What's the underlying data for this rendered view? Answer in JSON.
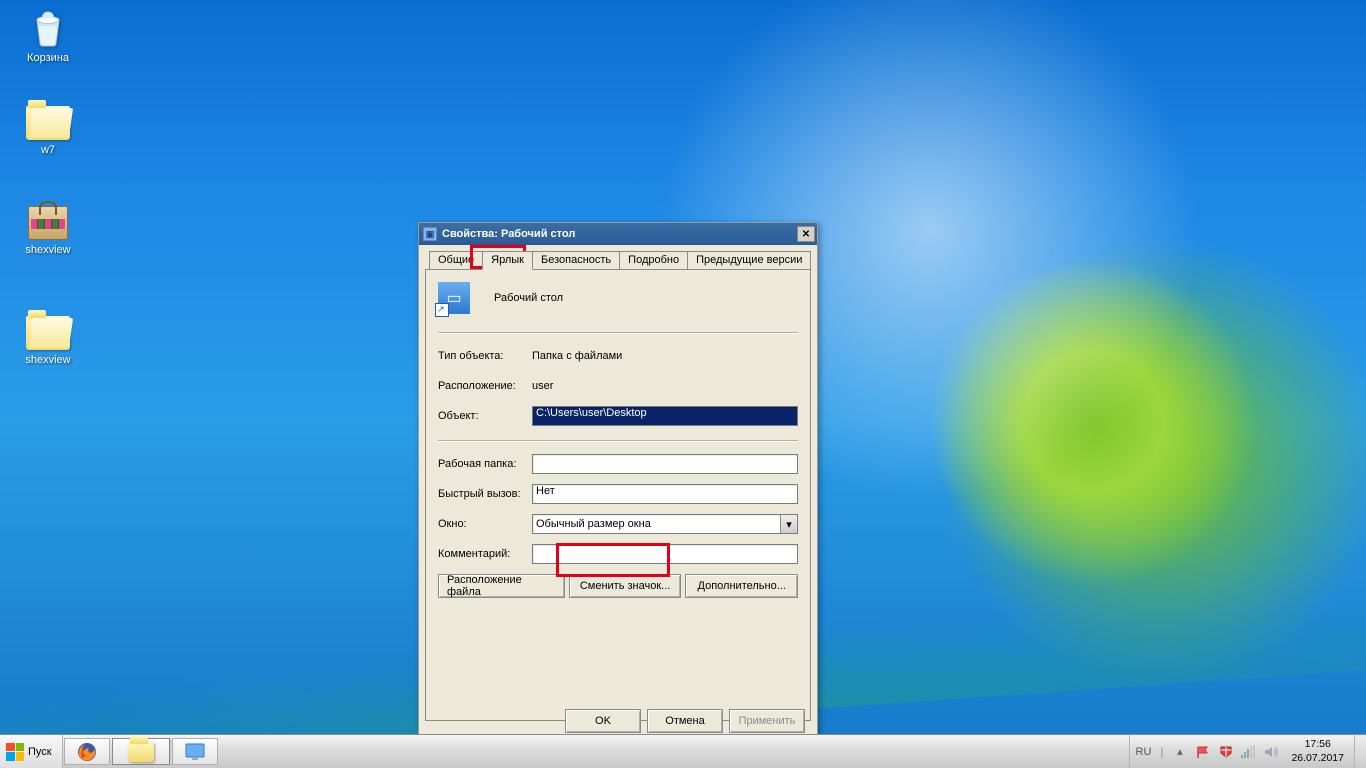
{
  "desktop": {
    "icons": [
      {
        "label": "Корзина"
      },
      {
        "label": "w7"
      },
      {
        "label": "shexview"
      },
      {
        "label": "shexview"
      }
    ]
  },
  "dialog": {
    "title": "Свойства: Рабочий стол",
    "tabs": {
      "general": "Общие",
      "shortcut": "Ярлык",
      "security": "Безопасность",
      "details": "Подробно",
      "previous": "Предыдущие версии"
    },
    "header_name": "Рабочий стол",
    "rows": {
      "type_label": "Тип объекта:",
      "type_value": "Папка с файлами",
      "location_label": "Расположение:",
      "location_value": "user",
      "target_label": "Объект:",
      "target_value": "C:\\Users\\user\\Desktop",
      "startin_label": "Рабочая папка:",
      "startin_value": "",
      "hotkey_label": "Быстрый вызов:",
      "hotkey_value": "Нет",
      "run_label": "Окно:",
      "run_value": "Обычный размер окна",
      "comment_label": "Комментарий:",
      "comment_value": ""
    },
    "buttons": {
      "file_location": "Расположение файла",
      "change_icon": "Сменить значок...",
      "advanced": "Дополнительно..."
    },
    "footer": {
      "ok": "OK",
      "cancel": "Отмена",
      "apply": "Применить"
    }
  },
  "taskbar": {
    "start": "Пуск",
    "lang": "RU",
    "time": "17:56",
    "date": "26.07.2017"
  }
}
